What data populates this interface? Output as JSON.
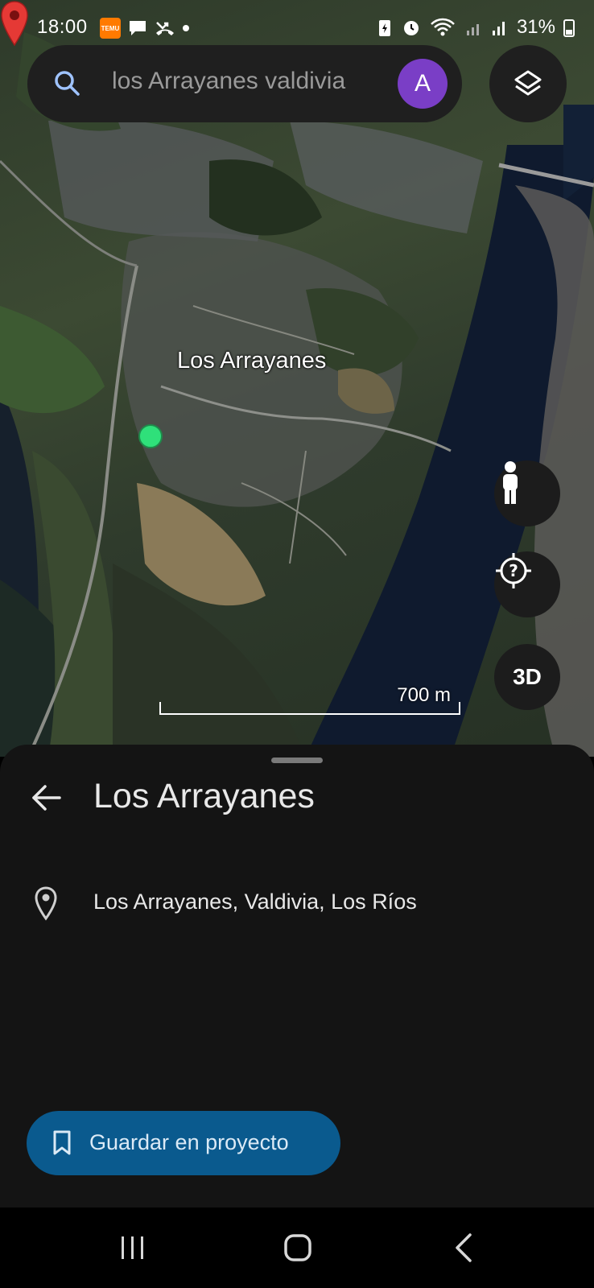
{
  "status_bar": {
    "time": "18:00",
    "battery": "31%",
    "icons_left": [
      "temu-app-icon",
      "chat-icon",
      "missed-call-icon",
      "dot-icon"
    ],
    "icons_right": [
      "battery-saver-icon",
      "alarm-icon",
      "wifi-icon",
      "signal-icon",
      "signal-icon",
      "battery-icon"
    ]
  },
  "search": {
    "query": "los Arrayanes valdivia",
    "avatar_initial": "A"
  },
  "map": {
    "place_label": "Los Arrayanes",
    "scale_label": "700 m",
    "buttons": {
      "three_d": "3D"
    },
    "colors": {
      "pin": "#e53935",
      "river": "#0f1a2e",
      "current_location": "#2fe07a"
    }
  },
  "sheet": {
    "title": "Los Arrayanes",
    "address": "Los Arrayanes, Valdivia, Los Ríos",
    "save_button": "Guardar en proyecto"
  },
  "colors": {
    "sheet_bg": "#141414",
    "save_button_bg": "#0a5a8e",
    "avatar_bg": "#7a3ec6"
  }
}
